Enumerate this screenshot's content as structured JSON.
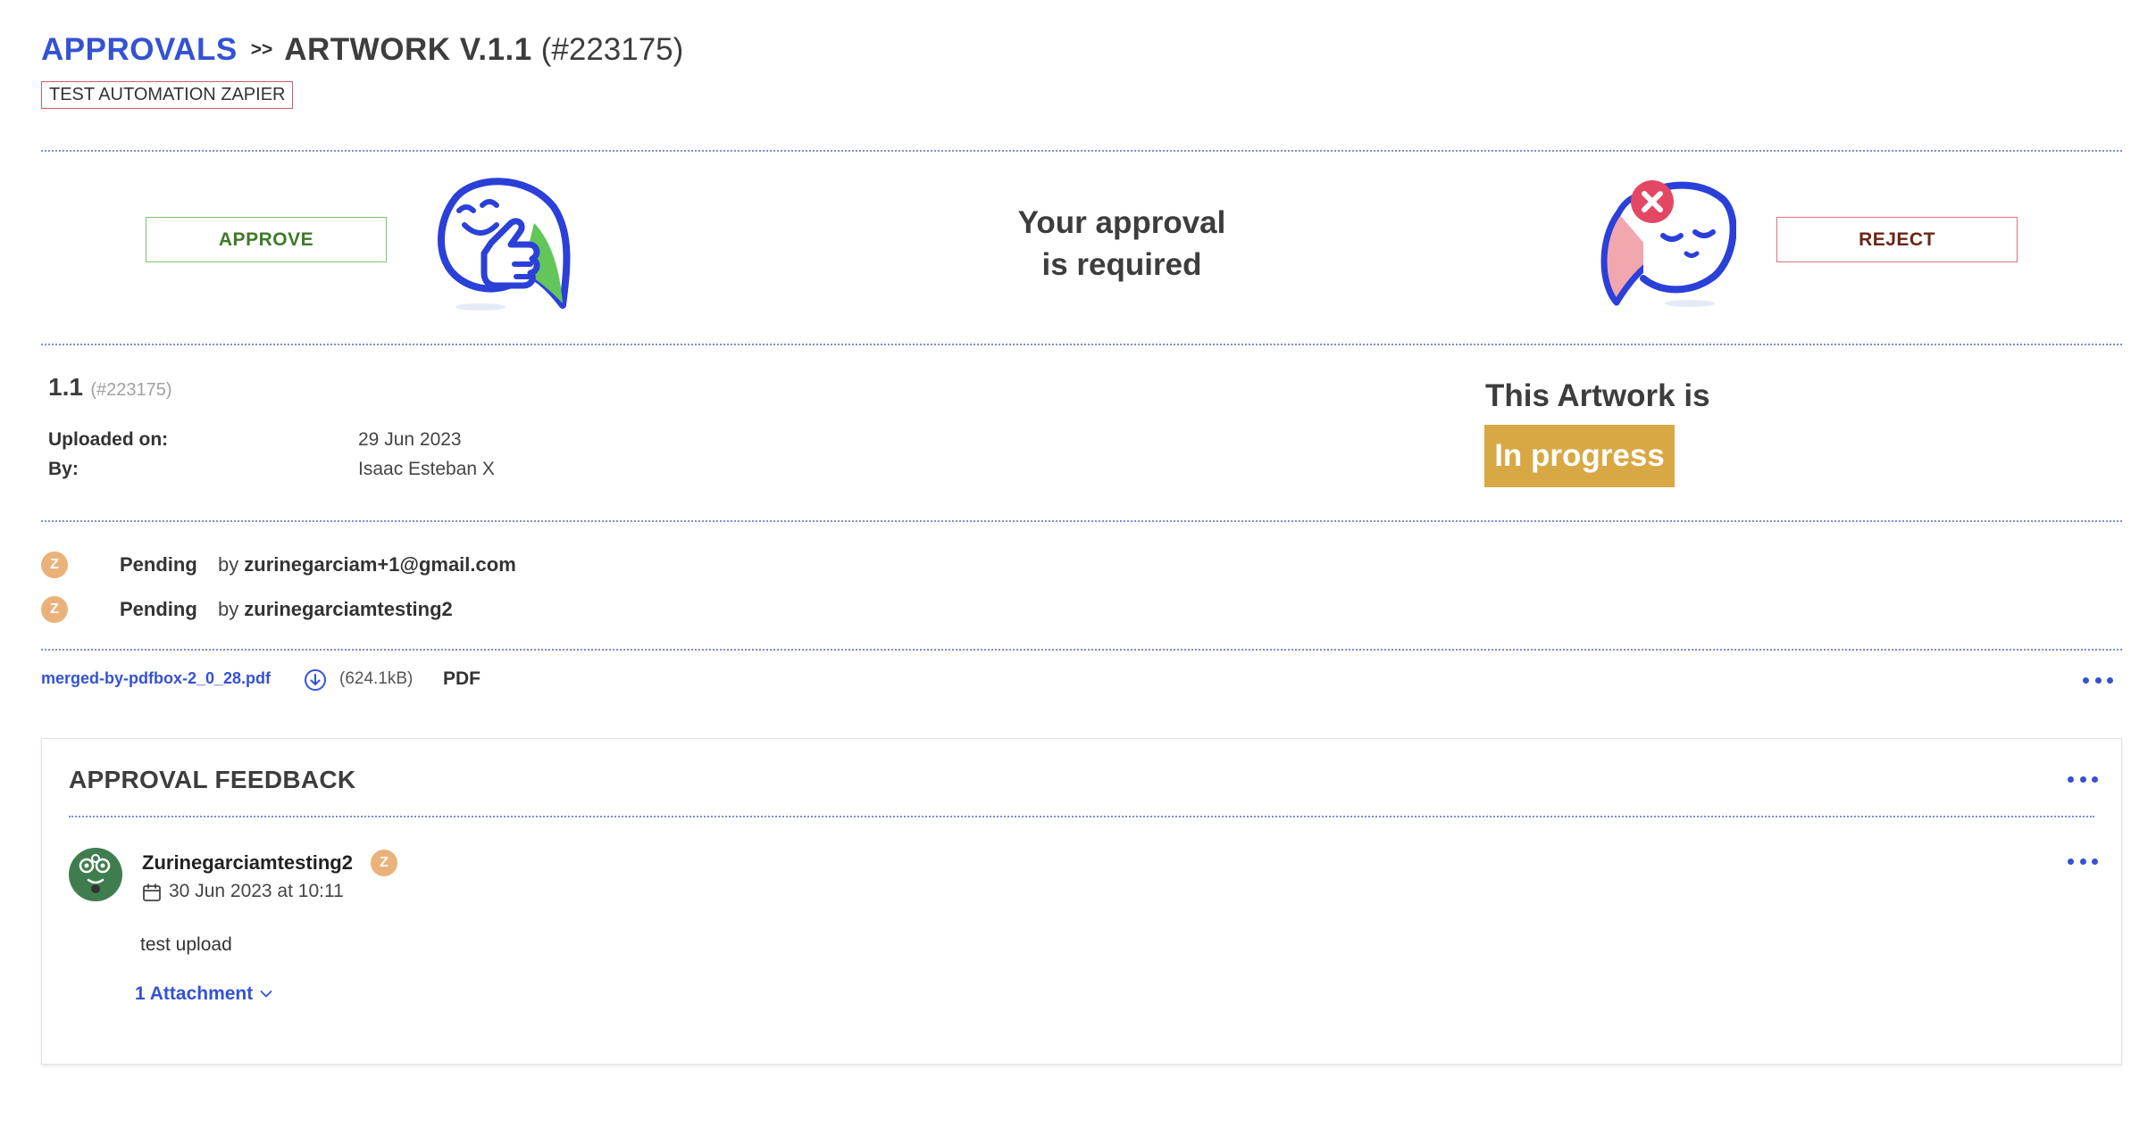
{
  "header": {
    "breadcrumb_root": "APPROVALS",
    "breadcrumb_separator": ">>",
    "title": "ARTWORK V.1.1",
    "id": "(#223175)",
    "project_tag": "TEST AUTOMATION ZAPIER"
  },
  "approval": {
    "approve_label": "APPROVE",
    "reject_label": "REJECT",
    "prompt_line1": "Your approval",
    "prompt_line2": "is required",
    "approve_icon": "thumbs-up-mascot-icon",
    "reject_icon": "reject-mascot-icon"
  },
  "version": {
    "number": "1.1",
    "id": "(#223175)",
    "uploaded_label": "Uploaded on:",
    "uploaded_value": "29 Jun 2023",
    "by_label": "By:",
    "by_value": "Isaac Esteban X"
  },
  "status": {
    "heading": "This Artwork is",
    "badge": "In progress",
    "badge_color": "#d8a844"
  },
  "approvers": [
    {
      "initial": "Z",
      "status": "Pending",
      "by": "by",
      "name": "zurinegarciam+1@gmail.com"
    },
    {
      "initial": "Z",
      "status": "Pending",
      "by": "by",
      "name": "zurinegarciamtesting2"
    }
  ],
  "file": {
    "name": "merged-by-pdfbox-2_0_28.pdf",
    "size": "(624.1kB)",
    "type": "PDF",
    "download_icon": "download-icon",
    "more_icon": "more-dots-icon"
  },
  "feedback": {
    "title": "APPROVAL FEEDBACK",
    "items": [
      {
        "user": "Zurinegarciamtesting2",
        "badge_initial": "Z",
        "date": "30 Jun 2023 at 10:11",
        "text": "test upload",
        "attachments": "1 Attachment"
      }
    ]
  },
  "colors": {
    "accent": "#3452d3",
    "approve": "#3f7a2a",
    "reject": "#6b2417",
    "divider": "#7c8dd8"
  }
}
